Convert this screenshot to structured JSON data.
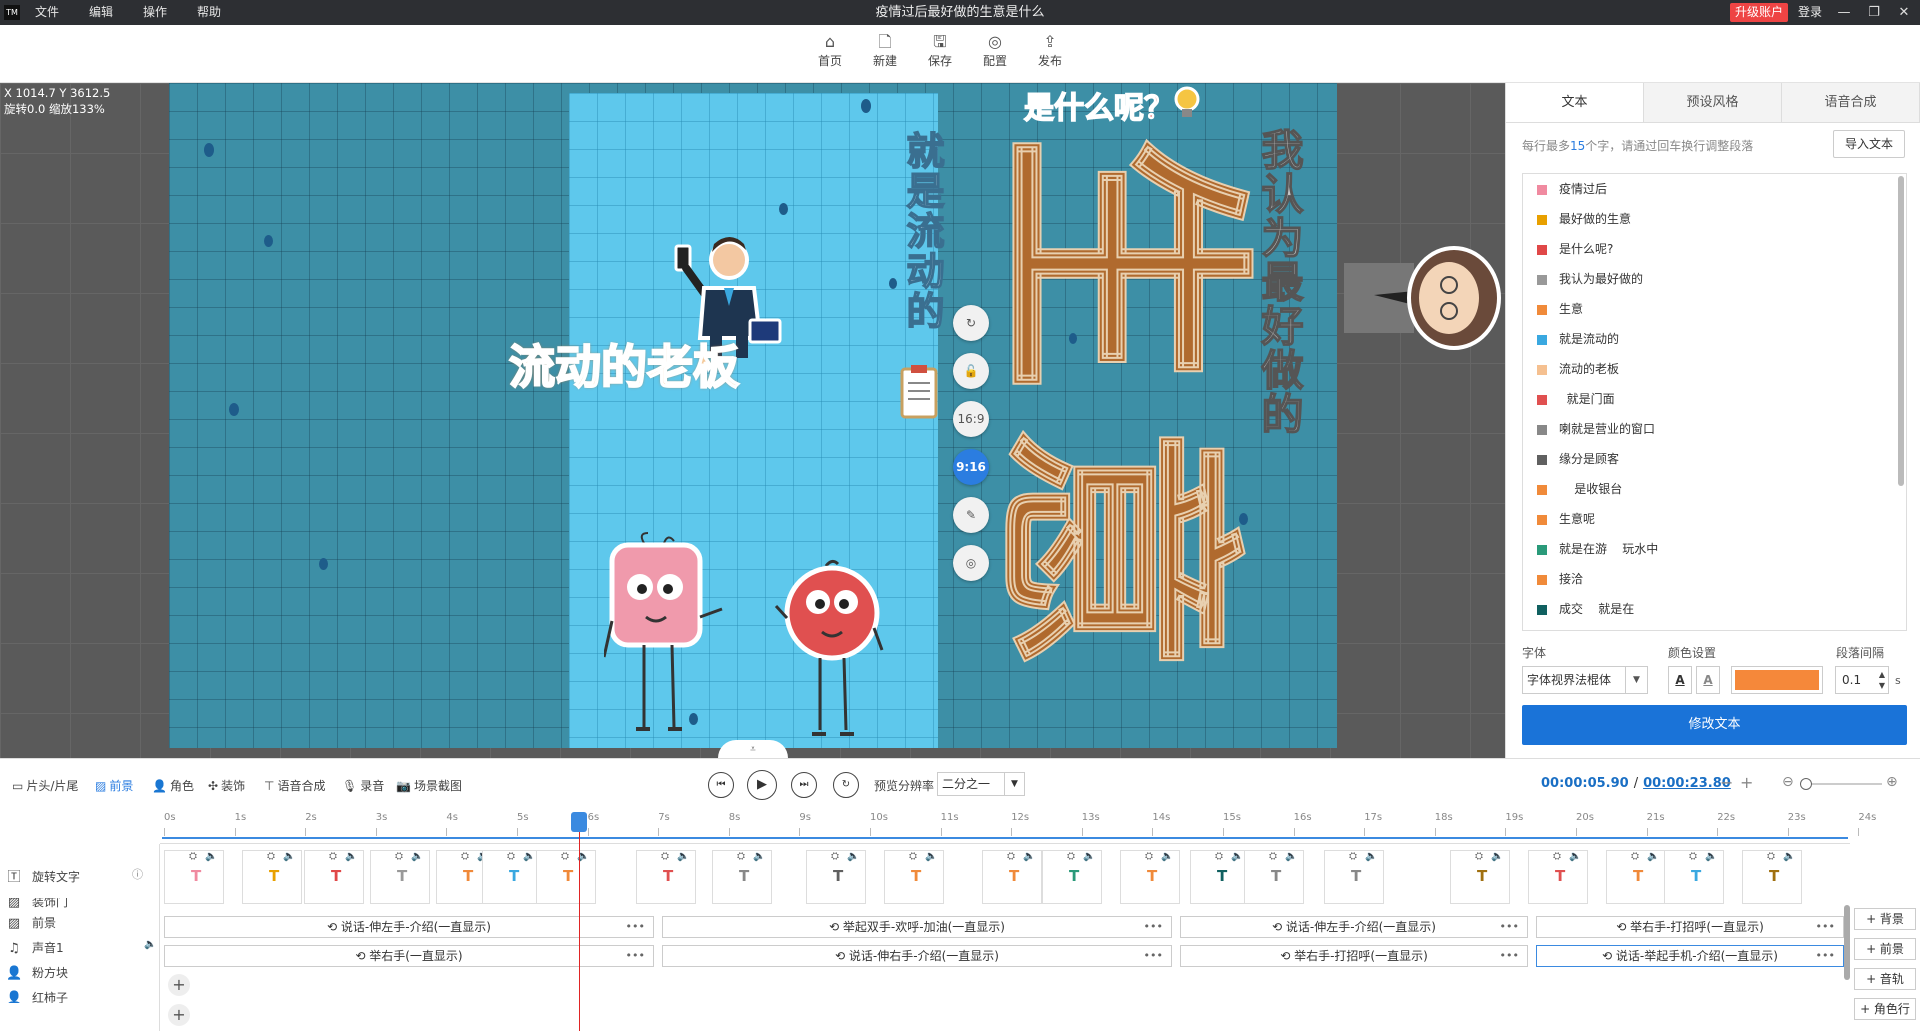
{
  "titlebar": {
    "logo": "TM",
    "menu": [
      "文件",
      "编辑",
      "操作",
      "帮助"
    ],
    "title": "疫情过后最好做的生意是什么",
    "upgrade": "升级账户",
    "login": "登录",
    "window_controls": [
      "—",
      "❐",
      "✕"
    ]
  },
  "toolbar": {
    "items": [
      {
        "label": "首页",
        "icon": "home-icon"
      },
      {
        "label": "新建",
        "icon": "new-file-icon"
      },
      {
        "label": "保存",
        "icon": "save-icon"
      },
      {
        "label": "配置",
        "icon": "settings-icon"
      },
      {
        "label": "发布",
        "icon": "publish-icon"
      }
    ]
  },
  "canvas": {
    "coords": "X 1014.7 Y 3612.5",
    "rotate_zoom": "旋转0.0 缩放133%",
    "texts": {
      "boss": "流动的老板",
      "flowing": "就是流动的",
      "question": "是什么呢？",
      "best": "我认为最好做的",
      "big1": "生",
      "big2": "意"
    },
    "side_controls": [
      "↻",
      "🔓",
      "16:9",
      "9:16",
      "✎",
      "◎"
    ]
  },
  "right_panel": {
    "tabs": [
      "文本",
      "预设风格",
      "语音合成"
    ],
    "hint_prefix": "每行最多",
    "hint_num": "15",
    "hint_suffix": "个字，请通过回车换行调整段落",
    "import_button": "导入文本",
    "text_lines": [
      {
        "text": "疫情过后",
        "color": "#f08aa0"
      },
      {
        "text": "最好做的生意",
        "color": "#e8a000"
      },
      {
        "text": "是什么呢?",
        "color": "#e04848"
      },
      {
        "text": "我认为最好做的",
        "color": "#999999"
      },
      {
        "text": "生意",
        "color": "#f08a3a"
      },
      {
        "text": "就是流动的",
        "color": "#3aa8e0"
      },
      {
        "text": "流动的老板",
        "color": "#f5c090"
      },
      {
        "text": "  就是门面",
        "color": "#e05050"
      },
      {
        "text": "喇就是营业的窗口",
        "color": "#888888"
      },
      {
        "text": "缘分是顾客",
        "color": "#606060"
      },
      {
        "text": "    是收银台",
        "color": "#f08a3a"
      },
      {
        "text": "生意呢",
        "color": "#f08a3a"
      },
      {
        "text": "就是在游    玩水中",
        "color": "#2a9a7a"
      },
      {
        "text": "接洽",
        "color": "#f08a3a"
      },
      {
        "text": "成交    就是在",
        "color": "#106060"
      }
    ],
    "font_label": "字体",
    "font_value": "字体视界法棍体",
    "color_label": "颜色设置",
    "spacing_label": "段落间隔",
    "spacing_value": "0.1",
    "spacing_unit": "s",
    "text_color": "#f5883a",
    "modify_button": "修改文本"
  },
  "controls": {
    "tabs": [
      {
        "label": "片头/片尾",
        "icon": "intro-icon"
      },
      {
        "label": "前景",
        "icon": "foreground-icon"
      },
      {
        "label": "角色",
        "icon": "character-icon"
      },
      {
        "label": "装饰",
        "icon": "decoration-icon"
      },
      {
        "label": "语音合成",
        "icon": "tts-icon"
      },
      {
        "label": "录音",
        "icon": "mic-icon"
      },
      {
        "label": "场景截图",
        "icon": "camera-icon"
      }
    ],
    "resolution_label": "预览分辨率",
    "resolution_value": "二分之一",
    "current_time": "00:00:05.90",
    "separator": "/",
    "total_time": "00:00:23.80"
  },
  "timeline": {
    "ticks": [
      "0s",
      "1s",
      "2s",
      "3s",
      "4s",
      "5s",
      "6s",
      "7s",
      "8s",
      "9s",
      "10s",
      "11s",
      "12s",
      "13s",
      "14s",
      "15s",
      "16s",
      "17s",
      "18s",
      "19s",
      "20s",
      "21s",
      "22s",
      "23s",
      "24s"
    ],
    "tracks": [
      "旋转文字",
      "装饰门",
      "前景",
      "声音1",
      "粉方块",
      "红柿子"
    ],
    "actions_row1": [
      "说话-伸左手-介绍(一直显示)",
      "举起双手-欢呼-加油(一直显示)",
      "说话-伸左手-介绍(一直显示)",
      "举右手-打招呼(一直显示)"
    ],
    "actions_row2": [
      "举右手(一直显示)",
      "说话-伸右手-介绍(一直显示)",
      "举右手-打招呼(一直显示)",
      "说话-举起手机-介绍(一直显示)"
    ],
    "side_buttons": [
      "+ 背景",
      "+ 前景",
      "+ 音轨",
      "+ 角色行"
    ]
  }
}
